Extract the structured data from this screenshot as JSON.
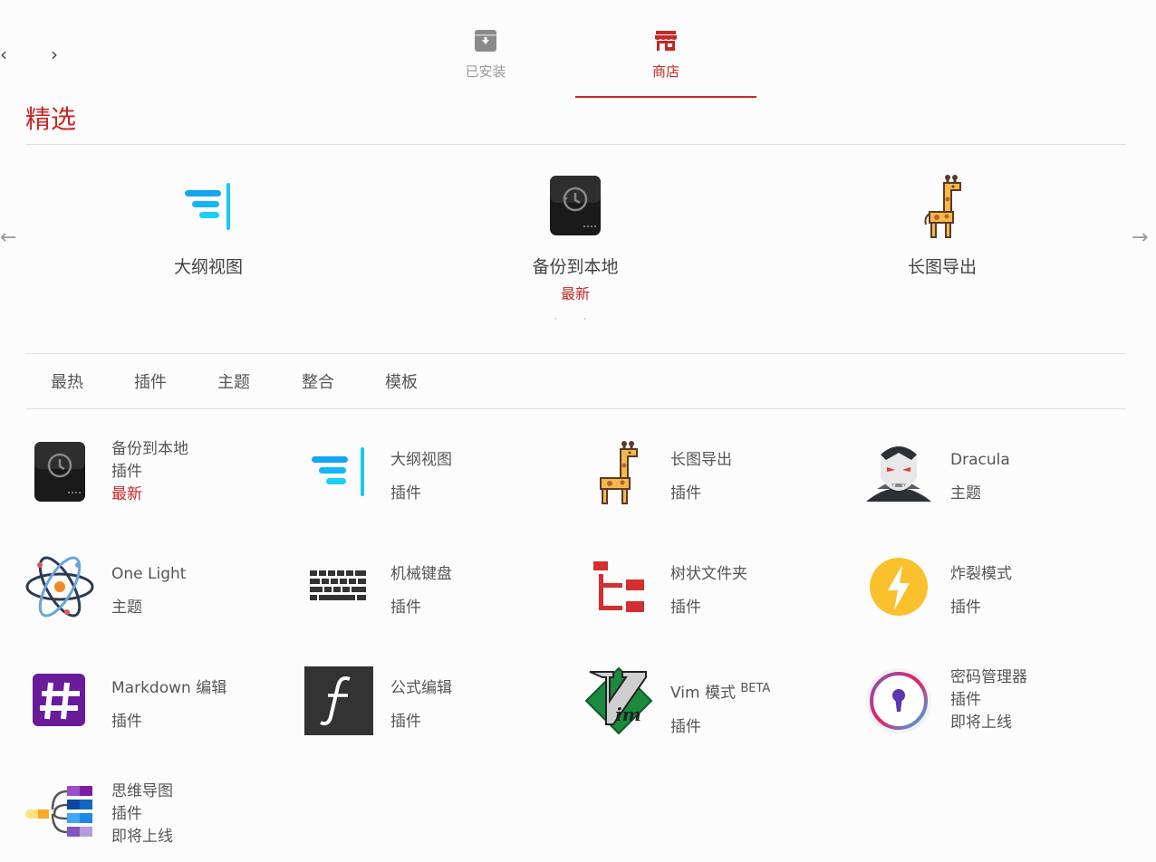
{
  "nav": {
    "back": "‹",
    "forward": "›"
  },
  "tabs": [
    {
      "label": "已安装",
      "icon": "archive-icon"
    },
    {
      "label": "商店",
      "icon": "store-icon"
    }
  ],
  "section_title": "精选",
  "featured": [
    {
      "name": "大纲视图",
      "badge": "",
      "icon": "outline-icon"
    },
    {
      "name": "备份到本地",
      "badge": "最新",
      "icon": "backup-drive-icon"
    },
    {
      "name": "长图导出",
      "badge": "",
      "icon": "giraffe-icon"
    }
  ],
  "carousel": {
    "prev": "←",
    "next": "→",
    "dots": "··"
  },
  "filters": [
    "最热",
    "插件",
    "主题",
    "整合",
    "模板"
  ],
  "cards": [
    {
      "name": "备份到本地",
      "type": "插件",
      "status": "最新",
      "icon": "backup-drive-icon"
    },
    {
      "name": "大纲视图",
      "type": "插件",
      "status": "",
      "icon": "outline-icon"
    },
    {
      "name": "长图导出",
      "type": "插件",
      "status": "",
      "icon": "giraffe-icon"
    },
    {
      "name": "Dracula",
      "type": "主题",
      "status": "",
      "icon": "dracula-icon"
    },
    {
      "name": "One Light",
      "type": "主题",
      "status": "",
      "icon": "atom-icon"
    },
    {
      "name": "机械键盘",
      "type": "插件",
      "status": "",
      "icon": "keyboard-icon"
    },
    {
      "name": "树状文件夹",
      "type": "插件",
      "status": "",
      "icon": "tree-folder-icon"
    },
    {
      "name": "炸裂模式",
      "type": "插件",
      "status": "",
      "icon": "lightning-icon"
    },
    {
      "name": "Markdown 编辑",
      "type": "插件",
      "status": "",
      "icon": "hash-icon"
    },
    {
      "name": "公式编辑",
      "type": "插件",
      "status": "",
      "icon": "formula-icon"
    },
    {
      "name": "Vim 模式",
      "beta": "BETA",
      "type": "插件",
      "status": "",
      "icon": "vim-icon"
    },
    {
      "name": "密码管理器",
      "type": "插件",
      "status": "即将上线",
      "icon": "keyhole-icon"
    },
    {
      "name": "思维导图",
      "type": "插件",
      "status": "即将上线",
      "icon": "mindmap-icon"
    }
  ],
  "colors": {
    "accent": "#c62828",
    "text": "#555555",
    "muted": "#999999"
  }
}
